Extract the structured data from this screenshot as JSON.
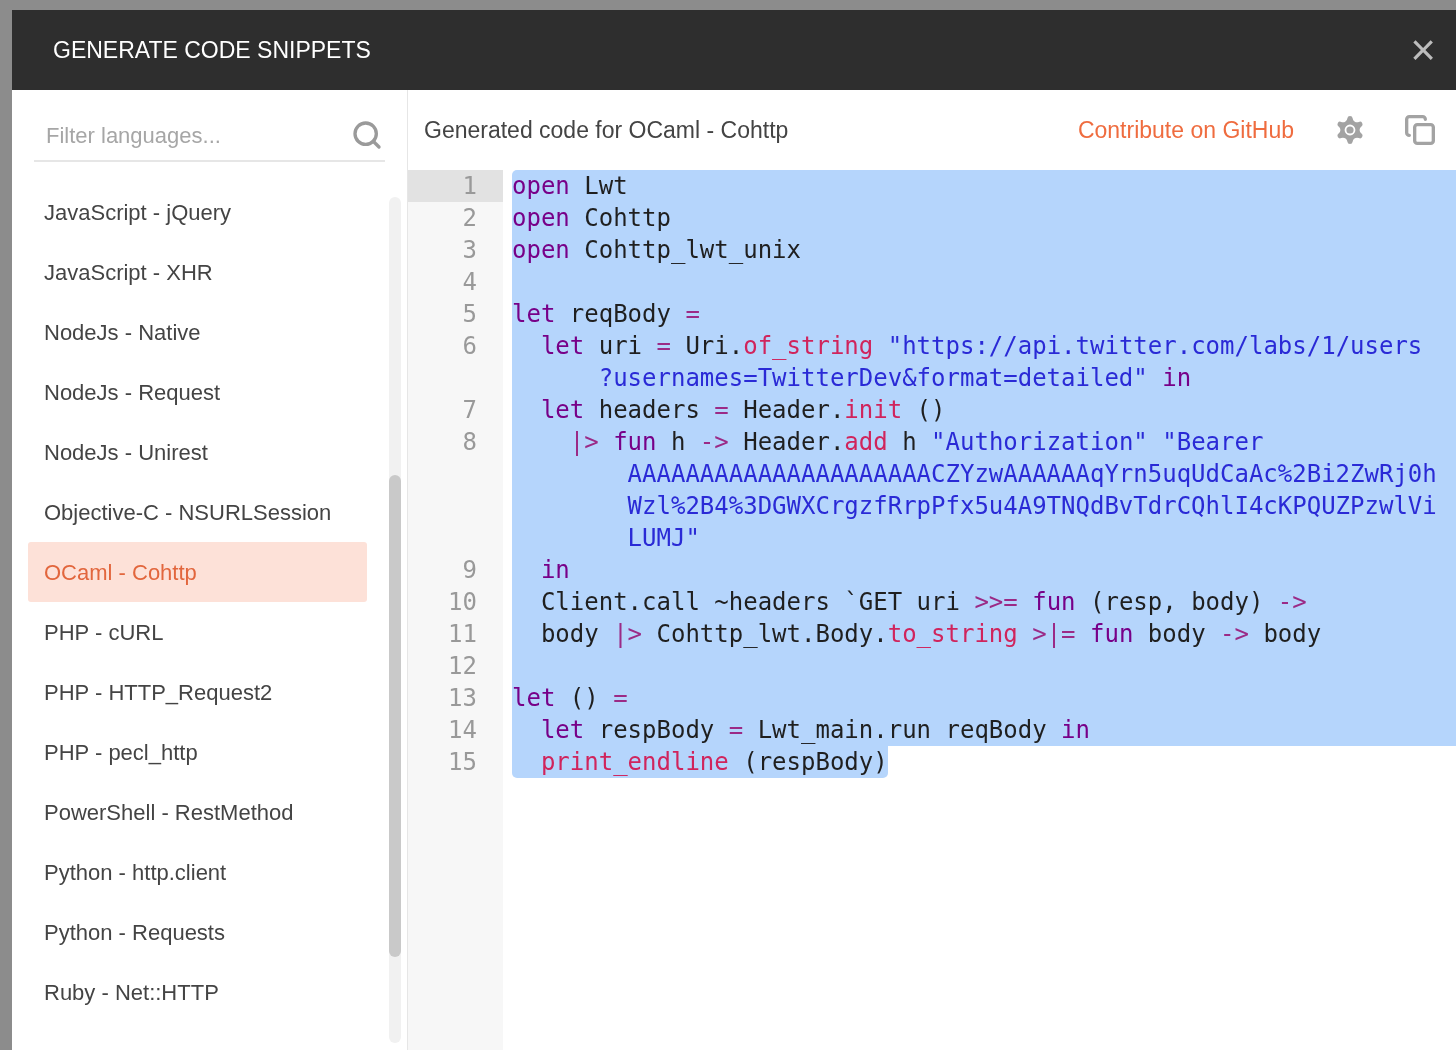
{
  "dialog": {
    "title": "GENERATE CODE SNIPPETS",
    "close": "×"
  },
  "sidebar": {
    "filter": {
      "placeholder": "Filter languages..."
    },
    "languages": [
      {
        "label": "JavaScript - jQuery",
        "selected": false
      },
      {
        "label": "JavaScript - XHR",
        "selected": false
      },
      {
        "label": "NodeJs - Native",
        "selected": false
      },
      {
        "label": "NodeJs - Request",
        "selected": false
      },
      {
        "label": "NodeJs - Unirest",
        "selected": false
      },
      {
        "label": "Objective-C - NSURLSession",
        "selected": false
      },
      {
        "label": "OCaml - Cohttp",
        "selected": true
      },
      {
        "label": "PHP - cURL",
        "selected": false
      },
      {
        "label": "PHP - HTTP_Request2",
        "selected": false
      },
      {
        "label": "PHP - pecl_http",
        "selected": false
      },
      {
        "label": "PowerShell - RestMethod",
        "selected": false
      },
      {
        "label": "Python - http.client",
        "selected": false
      },
      {
        "label": "Python - Requests",
        "selected": false
      },
      {
        "label": "Ruby - Net::HTTP",
        "selected": false
      }
    ]
  },
  "panel": {
    "title": "Generated code for OCaml - Cohttp",
    "contribute_link": "Contribute on GitHub"
  },
  "code": {
    "selected": true,
    "lines": [
      {
        "number": "1",
        "active": true,
        "rows": [
          {
            "tokens": [
              {
                "kind": "kw",
                "text": "open"
              },
              {
                "kind": "pl",
                "text": " Lwt"
              }
            ]
          }
        ]
      },
      {
        "number": "2",
        "active": false,
        "rows": [
          {
            "tokens": [
              {
                "kind": "kw",
                "text": "open"
              },
              {
                "kind": "pl",
                "text": " Cohttp"
              }
            ]
          }
        ]
      },
      {
        "number": "3",
        "active": false,
        "rows": [
          {
            "tokens": [
              {
                "kind": "kw",
                "text": "open"
              },
              {
                "kind": "pl",
                "text": " Cohttp_lwt_unix"
              }
            ]
          }
        ]
      },
      {
        "number": "4",
        "active": false
      },
      {
        "number": "5",
        "active": false,
        "rows": [
          {
            "tokens": [
              {
                "kind": "kw",
                "text": "let"
              },
              {
                "kind": "pl",
                "text": " reqBody "
              },
              {
                "kind": "op",
                "text": "="
              }
            ]
          }
        ]
      },
      {
        "number": "6",
        "active": false,
        "rows": [
          {
            "tokens": [
              {
                "kind": "kw",
                "text": "  let"
              },
              {
                "kind": "pl",
                "text": " uri "
              },
              {
                "kind": "op",
                "text": "="
              },
              {
                "kind": "pl",
                "text": " Uri."
              },
              {
                "kind": "fn",
                "text": "of_string"
              },
              {
                "kind": "str",
                "text": " \"https://api.twitter.com/labs/1/users"
              }
            ]
          },
          {
            "tokens": [
              {
                "kind": "str",
                "text": "      ?usernames=TwitterDev&format=detailed\""
              },
              {
                "kind": "kw",
                "text": " in"
              }
            ]
          }
        ]
      },
      {
        "number": "7",
        "active": false,
        "rows": [
          {
            "tokens": [
              {
                "kind": "kw",
                "text": "  let"
              },
              {
                "kind": "pl",
                "text": " headers "
              },
              {
                "kind": "op",
                "text": "="
              },
              {
                "kind": "pl",
                "text": " Header."
              },
              {
                "kind": "fn",
                "text": "init"
              },
              {
                "kind": "pl",
                "text": " ()"
              }
            ]
          }
        ]
      },
      {
        "number": "8",
        "active": false,
        "rows": [
          {
            "tokens": [
              {
                "kind": "op",
                "text": "    |>"
              },
              {
                "kind": "kw",
                "text": " fun"
              },
              {
                "kind": "pl",
                "text": " h "
              },
              {
                "kind": "op",
                "text": "->"
              },
              {
                "kind": "pl",
                "text": " Header."
              },
              {
                "kind": "fn",
                "text": "add"
              },
              {
                "kind": "pl",
                "text": " h "
              },
              {
                "kind": "str",
                "text": "\"Authorization\" \"Bearer"
              }
            ]
          },
          {
            "tokens": [
              {
                "kind": "str",
                "text": "        AAAAAAAAAAAAAAAAAAAAACZYzwAAAAAAqYrn5uqUdCaAc%2Bi2ZwRj0h"
              }
            ]
          },
          {
            "tokens": [
              {
                "kind": "str",
                "text": "        Wzl%2B4%3DGWXCrgzfRrpPfx5u4A9TNQdBvTdrCQhlI4cKPQUZPzwlVi"
              }
            ]
          },
          {
            "tokens": [
              {
                "kind": "str",
                "text": "        LUMJ\""
              }
            ]
          }
        ]
      },
      {
        "number": "9",
        "active": false,
        "rows": [
          {
            "tokens": [
              {
                "kind": "kw",
                "text": "  in"
              }
            ]
          }
        ]
      },
      {
        "number": "10",
        "active": false,
        "rows": [
          {
            "tokens": [
              {
                "kind": "pl",
                "text": "  Client.call ~headers `GET uri "
              },
              {
                "kind": "op",
                "text": ">>="
              },
              {
                "kind": "kw",
                "text": " fun"
              },
              {
                "kind": "pl",
                "text": " (resp, body) "
              },
              {
                "kind": "op",
                "text": "->"
              }
            ]
          }
        ]
      },
      {
        "number": "11",
        "active": false,
        "rows": [
          {
            "tokens": [
              {
                "kind": "pl",
                "text": "  body "
              },
              {
                "kind": "op",
                "text": "|>"
              },
              {
                "kind": "pl",
                "text": " Cohttp_lwt.Body."
              },
              {
                "kind": "fn",
                "text": "to_string"
              },
              {
                "kind": "op",
                "text": " >|="
              },
              {
                "kind": "kw",
                "text": " fun"
              },
              {
                "kind": "pl",
                "text": " body "
              },
              {
                "kind": "op",
                "text": "->"
              },
              {
                "kind": "pl",
                "text": " body"
              }
            ]
          }
        ]
      },
      {
        "number": "12",
        "active": false
      },
      {
        "number": "13",
        "active": false,
        "rows": [
          {
            "tokens": [
              {
                "kind": "kw",
                "text": "let"
              },
              {
                "kind": "pl",
                "text": " () "
              },
              {
                "kind": "op",
                "text": "="
              }
            ]
          }
        ]
      },
      {
        "number": "14",
        "active": false,
        "rows": [
          {
            "tokens": [
              {
                "kind": "kw",
                "text": "  let"
              },
              {
                "kind": "pl",
                "text": " respBody "
              },
              {
                "kind": "op",
                "text": "="
              },
              {
                "kind": "pl",
                "text": " Lwt_main.run reqBody "
              },
              {
                "kind": "kw",
                "text": "in"
              }
            ]
          }
        ]
      },
      {
        "number": "15",
        "active": false,
        "rows": [
          {
            "tokens": [
              {
                "kind": "fn",
                "text": "  print_endline"
              },
              {
                "kind": "pl",
                "text": " (respBody)"
              }
            ]
          }
        ]
      }
    ]
  }
}
